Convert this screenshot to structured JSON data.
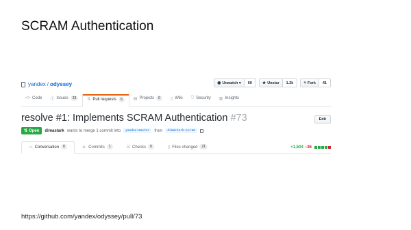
{
  "slide": {
    "title": "SCRAM Authentication",
    "footer_url": "https://github.com/yandex/odyssey/pull/73"
  },
  "repo": {
    "owner": "yandex",
    "separator": "/",
    "name": "odyssey"
  },
  "actions": [
    {
      "label": "Unwatch ▾",
      "count": "60",
      "icon": "eye-icon"
    },
    {
      "label": "Unstar",
      "count": "1.2k",
      "icon": "star-icon"
    },
    {
      "label": "Fork",
      "count": "41",
      "icon": "fork-icon"
    }
  ],
  "tabs": [
    {
      "label": "Code",
      "icon": "code-icon",
      "counter": null,
      "selected": false
    },
    {
      "label": "Issues",
      "icon": "issue-icon",
      "counter": "23",
      "selected": false
    },
    {
      "label": "Pull requests",
      "icon": "pull-request-icon",
      "counter": "6",
      "selected": true
    },
    {
      "label": "Projects",
      "icon": "project-icon",
      "counter": "0",
      "selected": false
    },
    {
      "label": "Wiki",
      "icon": "book-icon",
      "counter": null,
      "selected": false
    },
    {
      "label": "Security",
      "icon": "shield-icon",
      "counter": null,
      "selected": false
    },
    {
      "label": "Insights",
      "icon": "graph-icon",
      "counter": null,
      "selected": false
    }
  ],
  "pr": {
    "title": "resolve #1: Implements SCRAM Authentication",
    "number": "#73",
    "edit_label": "Edit",
    "state": "Open",
    "author": "dimastark",
    "action_text": "wants to merge 1 commit into",
    "base_branch": "yandex:master",
    "from_text": "from",
    "head_branch": "dimastark:scram"
  },
  "pr_tabs": [
    {
      "label": "Conversation",
      "counter": "0",
      "icon": "conversation-icon",
      "selected": true
    },
    {
      "label": "Commits",
      "counter": "1",
      "icon": "commit-icon",
      "selected": false
    },
    {
      "label": "Checks",
      "counter": "0",
      "icon": "checks-icon",
      "selected": false
    },
    {
      "label": "Files changed",
      "counter": "21",
      "icon": "file-diff-icon",
      "selected": false
    }
  ],
  "diffstat": {
    "additions": "+1,504",
    "deletions": "−36",
    "blocks": [
      "#28a745",
      "#28a745",
      "#28a745",
      "#28a745",
      "#cb2431"
    ]
  }
}
